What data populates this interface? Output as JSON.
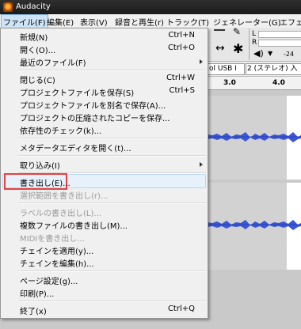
{
  "window": {
    "title": "Audacity"
  },
  "menubar": [
    "ファイル(F)",
    "編集(E)",
    "表示(V)",
    "録音と再生(r)",
    "トラック(T)",
    "ジェネレーター(G)",
    "エフェ"
  ],
  "background": {
    "meter": {
      "left": "L",
      "right": "R",
      "db": "-24"
    },
    "devices": {
      "input": "ol USB I",
      "channels": "2 (ステレオ) 入"
    },
    "ruler": [
      "3.0",
      "4.0"
    ]
  },
  "menu": {
    "items": [
      {
        "label": "新規(N)",
        "shortcut": "Ctrl+N"
      },
      {
        "label": "開く(O)...",
        "shortcut": "Ctrl+O"
      },
      {
        "label": "最近のファイル(F)",
        "shortcut": ""
      },
      {
        "label": "閉じる(C)",
        "shortcut": "Ctrl+W"
      },
      {
        "label": "プロジェクトファイルを保存(S)",
        "shortcut": "Ctrl+S"
      },
      {
        "label": "プロジェクトファイルを別名で保存(A)...",
        "shortcut": ""
      },
      {
        "label": "プロジェクトの圧縮されたコピーを保存...",
        "shortcut": ""
      },
      {
        "label": "依存性のチェック(k)...",
        "shortcut": ""
      },
      {
        "label": "メタデータエディタを開く(t)...",
        "shortcut": ""
      },
      {
        "label": "取り込み(I)",
        "shortcut": ""
      },
      {
        "label": "書き出し(E)...",
        "shortcut": ""
      },
      {
        "label": "選択範囲を書き出し(r)...",
        "shortcut": ""
      },
      {
        "label": "ラベルの書き出し(L)...",
        "shortcut": ""
      },
      {
        "label": "複数ファイルの書き出し(M)...",
        "shortcut": ""
      },
      {
        "label": "MIDIを書き出し...",
        "shortcut": ""
      },
      {
        "label": "チェインを適用(y)...",
        "shortcut": ""
      },
      {
        "label": "チェインを編集(h)...",
        "shortcut": ""
      },
      {
        "label": "ページ設定(g)...",
        "shortcut": ""
      },
      {
        "label": "印刷(P)...",
        "shortcut": ""
      },
      {
        "label": "終了(x)",
        "shortcut": "Ctrl+Q"
      }
    ]
  }
}
